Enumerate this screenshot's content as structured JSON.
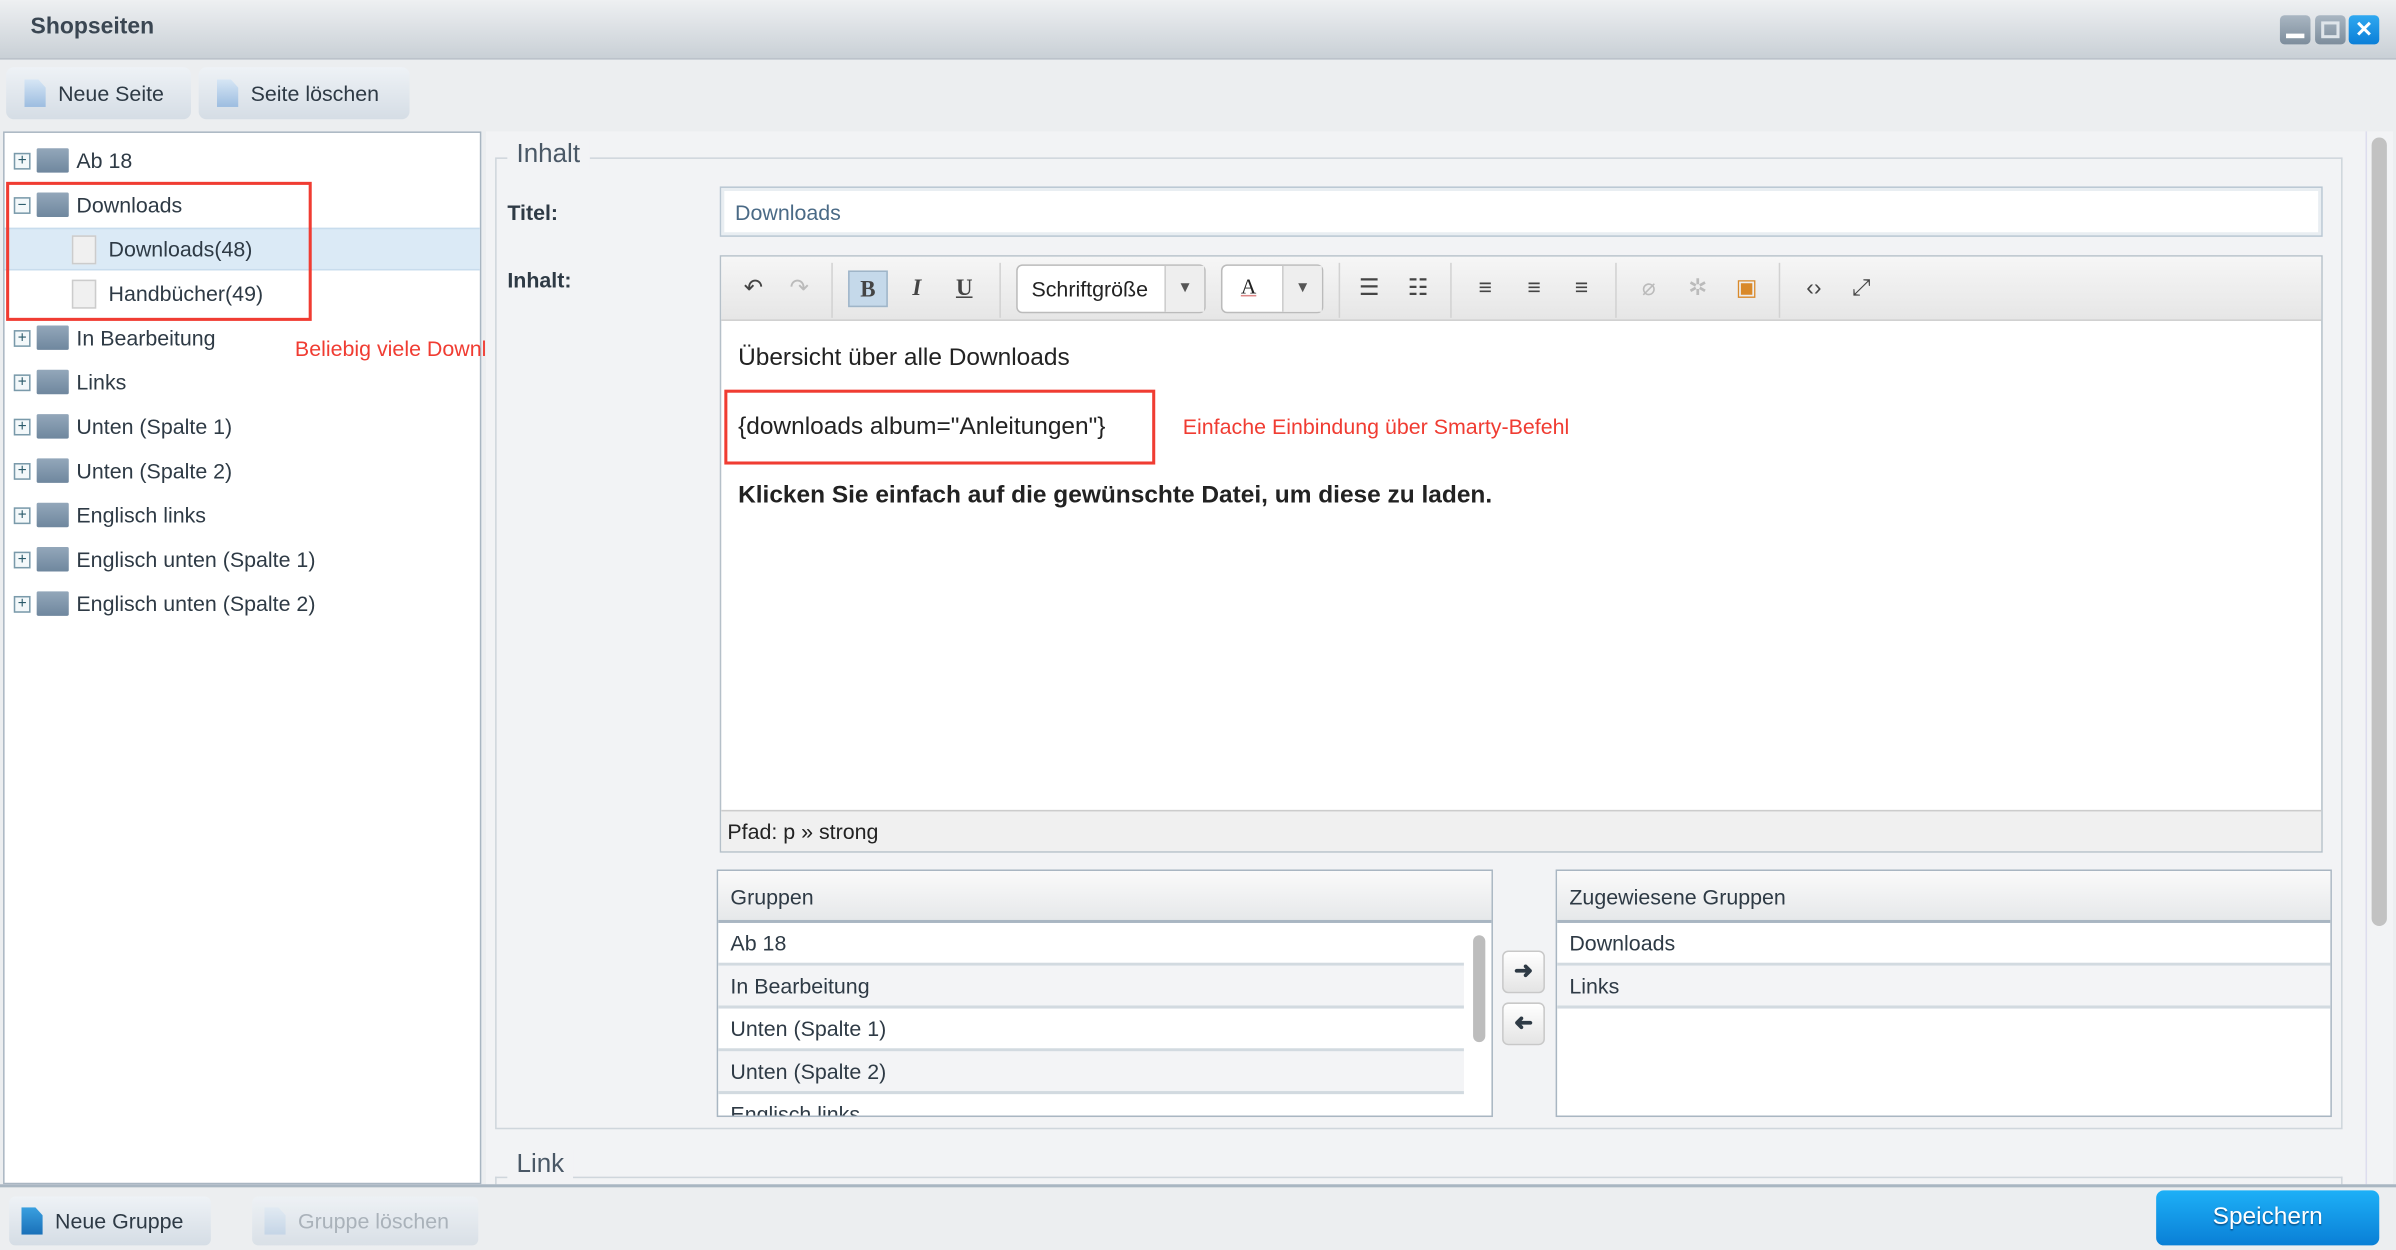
{
  "window": {
    "title": "Shopseiten",
    "controls": [
      "minimize",
      "maximize",
      "close"
    ]
  },
  "toolbar": {
    "new_page": "Neue Seite",
    "delete_page": "Seite löschen"
  },
  "tree": [
    {
      "label": "Ab 18",
      "expanded": false
    },
    {
      "label": "Downloads",
      "expanded": true,
      "children": [
        {
          "label": "Downloads(48)",
          "selected": true
        },
        {
          "label": "Handbücher(49)"
        }
      ]
    },
    {
      "label": "In Bearbeitung"
    },
    {
      "label": "Links"
    },
    {
      "label": "Unten (Spalte 1)"
    },
    {
      "label": "Unten (Spalte 2)"
    },
    {
      "label": "Englisch links"
    },
    {
      "label": "Englisch unten (Spalte 1)"
    },
    {
      "label": "Englisch unten (Spalte 2)"
    }
  ],
  "annotations": {
    "tree": "Beliebig viele Download-Seiten",
    "smarty": "Einfache Einbindung über Smarty-Befehl",
    "color": "#f03c32"
  },
  "form": {
    "section_title": "Inhalt",
    "titel_label": "Titel:",
    "titel_value": "Downloads",
    "inhalt_label": "Inhalt:",
    "editor": {
      "font_size_select": "Schriftgröße",
      "font_color_glyph": "A",
      "line1": "Übersicht über alle Downloads",
      "line2": "{downloads album=\"Anleitungen\"}",
      "line3": "Klicken Sie einfach auf die gewünschte Datei, um diese zu laden.",
      "path": "Pfad: p » strong"
    },
    "groups": {
      "header": "Gruppen",
      "items": [
        "Ab 18",
        "In Bearbeitung",
        "Unten (Spalte 1)",
        "Unten (Spalte 2)",
        "Englisch links"
      ]
    },
    "assigned": {
      "header": "Zugewiesene Gruppen",
      "items": [
        "Downloads",
        "Links"
      ]
    },
    "link_section": "Link"
  },
  "footer": {
    "new_group": "Neue Gruppe",
    "delete_group": "Gruppe löschen",
    "save": "Speichern"
  },
  "colors": {
    "accent": "#0a8fe6",
    "selection": "#dbeaf6"
  }
}
